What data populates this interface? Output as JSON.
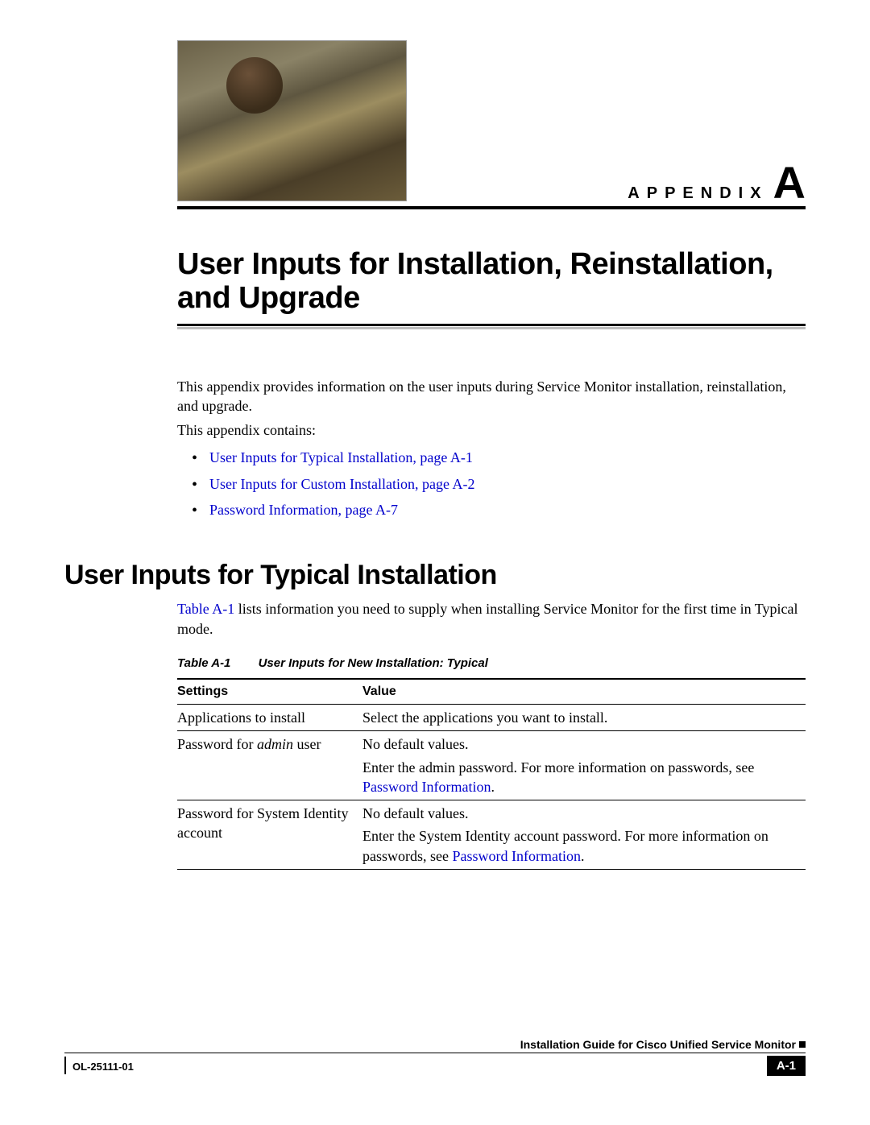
{
  "header": {
    "appendix_label": "APPENDIX",
    "appendix_letter": "A"
  },
  "title": "User Inputs for Installation, Reinstallation, and Upgrade",
  "intro": {
    "p1": "This appendix provides information on the user inputs during Service Monitor installation, reinstallation, and upgrade.",
    "p2": "This appendix contains:",
    "links": [
      "User Inputs for Typical Installation, page A-1",
      "User Inputs for Custom Installation, page A-2",
      "Password Information, page A-7"
    ]
  },
  "section": {
    "heading": "User Inputs for Typical Installation",
    "body_pre": "Table A-1",
    "body_post": " lists information you need to supply when installing Service Monitor for the first time in Typical mode."
  },
  "table": {
    "caption_num": "Table A-1",
    "caption_text": "User Inputs for New Installation: Typical",
    "headers": {
      "c1": "Settings",
      "c2": "Value"
    },
    "rows": [
      {
        "c1": "Applications to install",
        "c2": "Select the applications you want to install."
      },
      {
        "c1_pre": "Password for ",
        "c1_italic": "admin",
        "c1_post": " user",
        "c2_l1": "No default values.",
        "c2_l2_pre": "Enter the admin password. For more information on passwords, see ",
        "c2_l2_link": "Password Information",
        "c2_l2_post": "."
      },
      {
        "c1": "Password for System Identity account",
        "c2_l1": "No default values.",
        "c2_l2_pre": "Enter the System Identity account password. For more information on passwords, see ",
        "c2_l2_link": "Password Information",
        "c2_l2_post": "."
      }
    ]
  },
  "footer": {
    "guide": "Installation Guide for Cisco Unified Service Monitor",
    "docnum": "OL-25111-01",
    "pagenum": "A-1"
  }
}
